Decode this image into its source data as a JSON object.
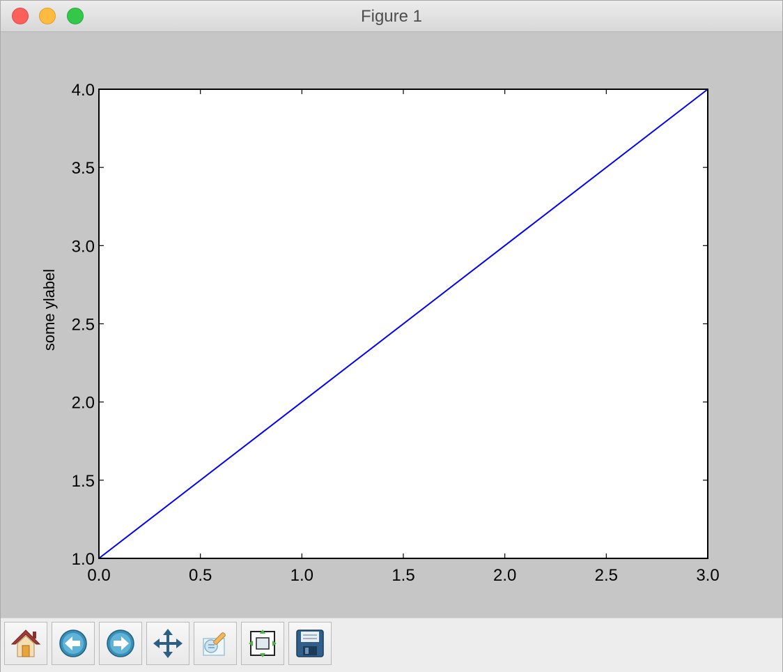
{
  "window": {
    "title": "Figure 1"
  },
  "toolbar": {
    "buttons": [
      {
        "name": "home",
        "icon": "home-icon"
      },
      {
        "name": "back",
        "icon": "back-arrow-icon"
      },
      {
        "name": "forward",
        "icon": "forward-arrow-icon"
      },
      {
        "name": "pan",
        "icon": "move-arrows-icon"
      },
      {
        "name": "zoom-to-rect",
        "icon": "zoom-rect-icon"
      },
      {
        "name": "subplots",
        "icon": "subplots-config-icon"
      },
      {
        "name": "save",
        "icon": "floppy-disk-icon"
      }
    ]
  },
  "colors": {
    "line": "#0000ff",
    "figure_background": "#c6c6c6",
    "axes_background": "#ffffff"
  },
  "chart_data": {
    "type": "line",
    "title": "",
    "xlabel": "",
    "ylabel": "some ylabel",
    "xlim": [
      0.0,
      3.0
    ],
    "ylim": [
      1.0,
      4.0
    ],
    "xticks": [
      "0.0",
      "0.5",
      "1.0",
      "1.5",
      "2.0",
      "2.5",
      "3.0"
    ],
    "yticks": [
      "1.0",
      "1.5",
      "2.0",
      "2.5",
      "3.0",
      "3.5",
      "4.0"
    ],
    "grid": false,
    "series": [
      {
        "x": [
          0,
          1,
          2,
          3
        ],
        "y": [
          1,
          2,
          3,
          4
        ]
      }
    ]
  }
}
